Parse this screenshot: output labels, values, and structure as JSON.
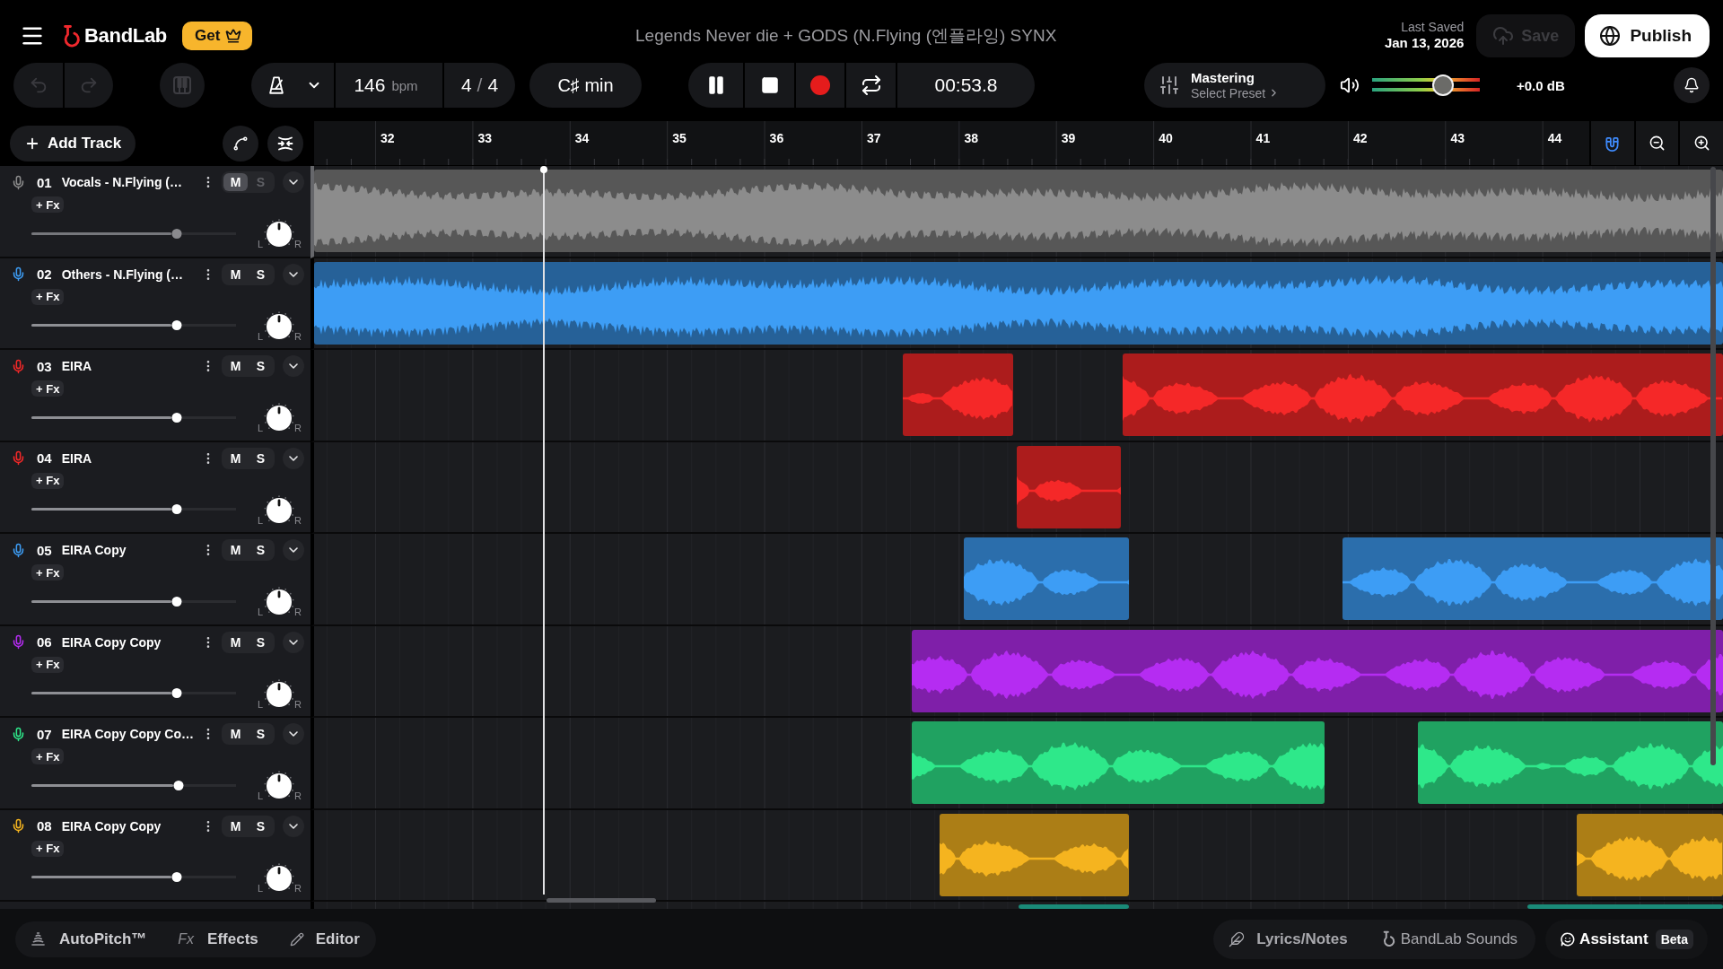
{
  "logo": {
    "name": "BandLab"
  },
  "get_button": {
    "label": "Get"
  },
  "project_title": "Legends Never die + GODS (N.Flying (엔플라잉) SYNX",
  "last_saved": {
    "label": "Last Saved",
    "date": "Jan 13, 2026"
  },
  "save_button": {
    "label": "Save",
    "disabled": true
  },
  "publish_button": {
    "label": "Publish"
  },
  "undo": {
    "disabled": true
  },
  "redo": {
    "disabled": true
  },
  "tempo": {
    "value": "146",
    "unit": "bpm"
  },
  "time_signature": {
    "beats": "4",
    "separator": "/",
    "unit": "4"
  },
  "key": "C♯ min",
  "transport": {
    "playing": true,
    "time": "00:53.8"
  },
  "mastering": {
    "title": "Mastering",
    "preset": "Select Preset"
  },
  "master_volume": {
    "level": 0.66,
    "reading": "+0.0 dB"
  },
  "add_track": {
    "label": "Add Track"
  },
  "snap": {
    "on": true
  },
  "ruler": {
    "bars": [
      "32",
      "33",
      "34",
      "35",
      "36",
      "37",
      "38",
      "39",
      "40",
      "41",
      "42",
      "43",
      "44"
    ]
  },
  "playhead": {
    "level": 0.163
  },
  "tracks": [
    {
      "number": "01",
      "name": "Vocals - N.Flying (…",
      "color": "#8c8c8c",
      "selected": true,
      "muted": true,
      "soloed": false,
      "mute_label": "M",
      "solo_label": "S",
      "fx_label": "+ Fx",
      "volume": {
        "level": 0.71
      },
      "pan": {
        "level": 0.5,
        "left": "L",
        "right": "R"
      }
    },
    {
      "number": "02",
      "name": "Others - N.Flying (…",
      "color": "#3d9df5",
      "selected": false,
      "muted": false,
      "soloed": false,
      "mute_label": "M",
      "solo_label": "S",
      "fx_label": "+ Fx",
      "volume": {
        "level": 0.71
      },
      "pan": {
        "level": 0.5,
        "left": "L",
        "right": "R"
      }
    },
    {
      "number": "03",
      "name": "EIRA",
      "color": "#f52828",
      "selected": false,
      "muted": false,
      "soloed": false,
      "mute_label": "M",
      "solo_label": "S",
      "fx_label": "+ Fx",
      "volume": {
        "level": 0.71
      },
      "pan": {
        "level": 0.5,
        "left": "L",
        "right": "R"
      }
    },
    {
      "number": "04",
      "name": "EIRA",
      "color": "#f52828",
      "selected": false,
      "muted": false,
      "soloed": false,
      "mute_label": "M",
      "solo_label": "S",
      "fx_label": "+ Fx",
      "volume": {
        "level": 0.71
      },
      "pan": {
        "level": 0.5,
        "left": "L",
        "right": "R"
      }
    },
    {
      "number": "05",
      "name": "EIRA Copy",
      "color": "#3d9df5",
      "selected": false,
      "muted": false,
      "soloed": false,
      "mute_label": "M",
      "solo_label": "S",
      "fx_label": "+ Fx",
      "volume": {
        "level": 0.71
      },
      "pan": {
        "level": 0.5,
        "left": "L",
        "right": "R"
      }
    },
    {
      "number": "06",
      "name": "EIRA Copy Copy",
      "color": "#b52cf2",
      "selected": false,
      "muted": false,
      "soloed": false,
      "mute_label": "M",
      "solo_label": "S",
      "fx_label": "+ Fx",
      "volume": {
        "level": 0.71
      },
      "pan": {
        "level": 0.5,
        "left": "L",
        "right": "R"
      }
    },
    {
      "number": "07",
      "name": "EIRA Copy Copy Co…",
      "color": "#2ee88a",
      "selected": false,
      "muted": false,
      "soloed": false,
      "mute_label": "M",
      "solo_label": "S",
      "fx_label": "+ Fx",
      "volume": {
        "level": 0.72
      },
      "pan": {
        "level": 0.5,
        "left": "L",
        "right": "R"
      }
    },
    {
      "number": "08",
      "name": "EIRA Copy Copy",
      "color": "#f5b41f",
      "selected": false,
      "muted": false,
      "soloed": false,
      "mute_label": "M",
      "solo_label": "S",
      "fx_label": "+ Fx",
      "volume": {
        "level": 0.71
      },
      "pan": {
        "level": 0.5,
        "left": "L",
        "right": "R"
      }
    }
  ],
  "next_track": {
    "color": "#1a8a78"
  },
  "bottom_bar": {
    "tools": [
      {
        "kind": "autopitch",
        "label": "AutoPitch™"
      },
      {
        "kind": "effects",
        "glyph": "Fx",
        "label": "Effects"
      },
      {
        "kind": "editor",
        "label": "Editor"
      }
    ],
    "panels": [
      {
        "kind": "lyrics",
        "label": "Lyrics/Notes"
      },
      {
        "kind": "sounds",
        "label": "BandLab Sounds"
      }
    ],
    "assistant": {
      "label": "Assistant",
      "badge": "Beta"
    }
  }
}
